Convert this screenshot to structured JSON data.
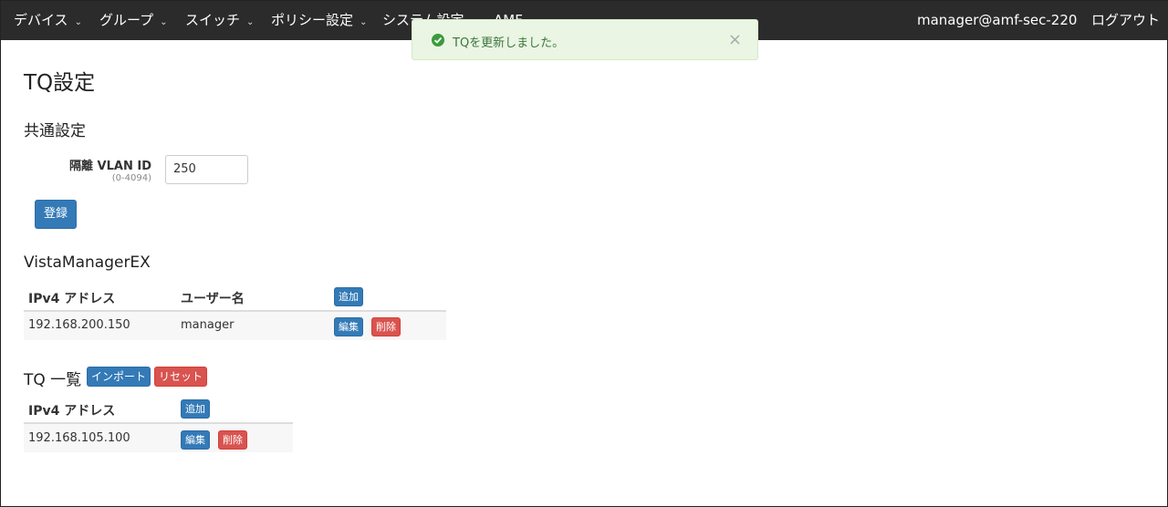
{
  "nav": {
    "items": [
      {
        "label": "デバイス",
        "caret": "⌄"
      },
      {
        "label": "グループ",
        "caret": "⌄"
      },
      {
        "label": "スイッチ",
        "caret": "⌄"
      },
      {
        "label": "ポリシー設定",
        "caret": "⌄"
      },
      {
        "label": "システム設定",
        "caret": ""
      },
      {
        "label": "AMF",
        "caret": ""
      }
    ],
    "user": "manager@amf-sec-220",
    "logout": "ログアウト"
  },
  "toast": {
    "message": "TQを更新しました。",
    "close": "×"
  },
  "page": {
    "title": "TQ設定"
  },
  "common": {
    "heading": "共通設定",
    "vlan_label": "隔離 VLAN ID",
    "vlan_range": "(0-4094)",
    "vlan_value": "250",
    "submit": "登録"
  },
  "vista": {
    "heading": "VistaManagerEX",
    "col_ip": "IPv4 アドレス",
    "col_user": "ユーザー名",
    "add": "追加",
    "rows": [
      {
        "ip": "192.168.200.150",
        "user": "manager",
        "edit": "編集",
        "delete": "削除"
      }
    ]
  },
  "tq": {
    "heading": "TQ 一覧",
    "import": "インポート",
    "reset": "リセット",
    "col_ip": "IPv4 アドレス",
    "add": "追加",
    "rows": [
      {
        "ip": "192.168.105.100",
        "edit": "編集",
        "delete": "削除"
      }
    ]
  },
  "colors": {
    "navbar": "#2b2b2b",
    "primary": "#337ab7",
    "danger": "#d9534f",
    "success_bg": "#eaf5e3"
  }
}
